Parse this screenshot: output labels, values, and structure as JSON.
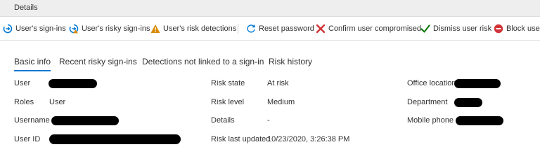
{
  "window": {
    "title": "Details"
  },
  "toolbar": {
    "buttons": [
      {
        "label": "User's sign-ins",
        "icon": "sign-ins-icon"
      },
      {
        "label": "User's risky sign-ins",
        "icon": "risky-sign-ins-icon"
      },
      {
        "label": "User's risk detections",
        "icon": "warning-icon"
      },
      {
        "label": "Reset password",
        "icon": "refresh-icon"
      },
      {
        "label": "Confirm user compromised",
        "icon": "x-icon"
      },
      {
        "label": "Dismiss user risk",
        "icon": "checkmark-icon"
      },
      {
        "label": "Block user",
        "icon": "block-icon"
      }
    ],
    "colors": {
      "blue": "#0078d4",
      "orange": "#d88a00",
      "red": "#d13438",
      "green": "#107c10"
    }
  },
  "tabs": [
    {
      "label": "Basic info",
      "active": true
    },
    {
      "label": "Recent risky sign-ins",
      "active": false
    },
    {
      "label": "Detections not linked to a sign-in",
      "active": false
    },
    {
      "label": "Risk history",
      "active": false
    }
  ],
  "details": {
    "col1": [
      {
        "label": "User",
        "value": ""
      },
      {
        "label": "Roles",
        "value": "User"
      },
      {
        "label": "Username",
        "value": ""
      },
      {
        "label": "User ID",
        "value": ""
      }
    ],
    "col2": [
      {
        "label": "Risk state",
        "value": "At risk"
      },
      {
        "label": "Risk level",
        "value": "Medium"
      },
      {
        "label": "Details",
        "value": "-"
      },
      {
        "label": "Risk last updated",
        "value": "10/23/2020, 3:26:38 PM"
      }
    ],
    "col3": [
      {
        "label": "Office location",
        "value": ""
      },
      {
        "label": "Department",
        "value": ""
      },
      {
        "label": "Mobile phone",
        "value": ""
      }
    ]
  }
}
